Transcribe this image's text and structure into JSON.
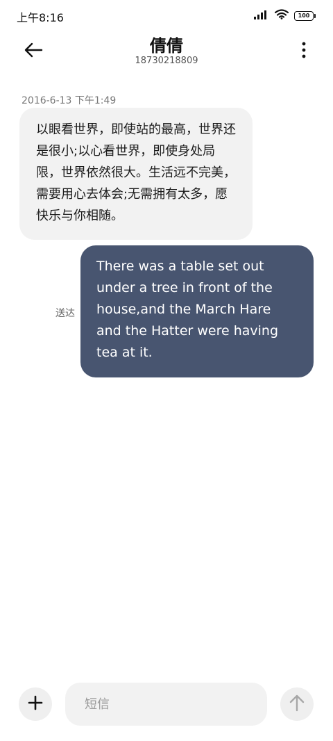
{
  "status_bar": {
    "time": "上午8:16",
    "battery": "100",
    "icons": [
      "signal-icon",
      "wifi-icon",
      "battery-icon"
    ]
  },
  "header": {
    "contact_name": "倩倩",
    "contact_number": "18730218809",
    "icons": [
      "back-arrow-icon",
      "more-vertical-icon"
    ]
  },
  "conversation": {
    "timestamp": "2016-6-13 下午1:49",
    "incoming": {
      "text": "以眼看世界，即使站的最高，世界还是很小;以心看世界，即使身处局限，世界依然很大。生活远不完美，需要用心去体会;无需拥有太多，愿快乐与你相随。"
    },
    "outgoing": {
      "text": "There was a table set out under a tree in front of the house,and the March Hare and the Hatter were having tea at it.",
      "status": "送达"
    }
  },
  "composer": {
    "placeholder": "短信",
    "value": "",
    "icons": [
      "plus-icon",
      "send-arrow-icon"
    ]
  },
  "colors": {
    "outgoing_bubble": "#485570",
    "incoming_bubble": "#f2f2f2",
    "input_background": "#f2f2f2",
    "button_background": "#efefef"
  }
}
